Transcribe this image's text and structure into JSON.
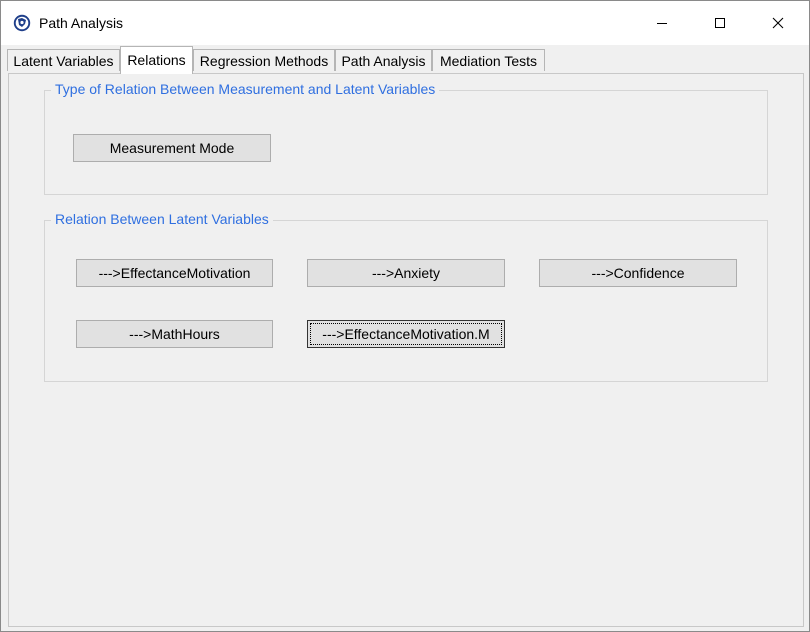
{
  "window": {
    "title": "Path Analysis",
    "icon": "app-globe-icon",
    "controls": [
      "minimize-icon",
      "maximize-icon",
      "close-icon"
    ]
  },
  "tabs": [
    {
      "label": "Latent Variables",
      "active": false
    },
    {
      "label": "Relations",
      "active": true
    },
    {
      "label": "Regression Methods",
      "active": false
    },
    {
      "label": "Path Analysis",
      "active": false
    },
    {
      "label": "Mediation Tests",
      "active": false
    }
  ],
  "measurement_group": {
    "title": "Type of Relation Between Measurement and Latent Variables",
    "button": "Measurement Mode"
  },
  "latent_group": {
    "title": "Relation Between Latent Variables",
    "buttons": [
      "--->EffectanceMotivation",
      "--->Anxiety",
      "--->Confidence",
      "--->MathHours",
      "--->EffectanceMotivation.M"
    ]
  },
  "colors": {
    "group_title": "#2f6fe0",
    "button_bg": "#e1e1e1",
    "window_bg": "#f0f0f0"
  }
}
